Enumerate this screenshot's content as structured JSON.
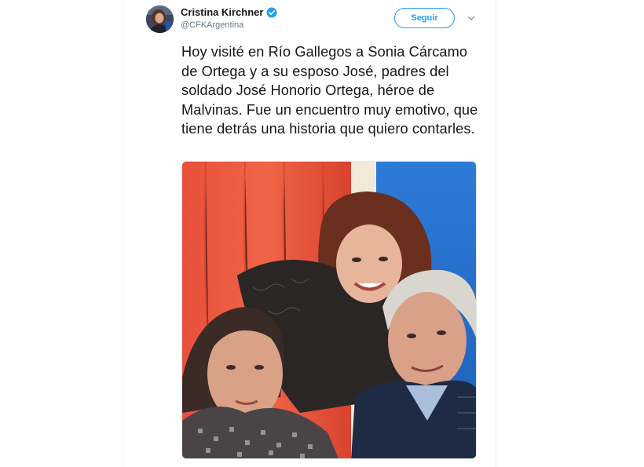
{
  "tweet": {
    "author_name": "Cristina Kirchner",
    "author_handle": "@CFKArgentina",
    "verified": true,
    "follow_label": "Seguir",
    "menu_icon": "chevron-down-icon",
    "text": "Hoy visité en Río Gallegos a Sonia Cárcamo de Ortega y a su esposo José, padres del soldado José Honorio Ortega, héroe de Malvinas. Fue un encuentro muy emotivo, que tiene detrás una historia que quiero contarles."
  },
  "colors": {
    "accent": "#1da1f2",
    "text": "#14171a",
    "muted": "#657786"
  }
}
